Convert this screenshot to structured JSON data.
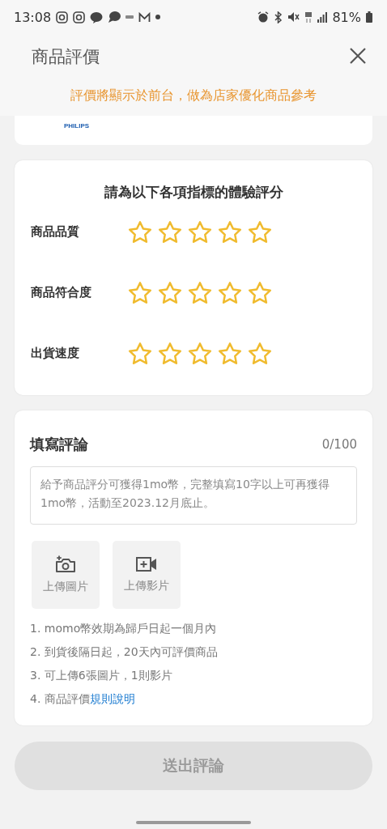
{
  "status_bar": {
    "time": "13:08",
    "battery": "81%"
  },
  "header": {
    "title": "商品評價",
    "notice": "評價將顯示於前台，做為店家優化商品參考"
  },
  "product": {
    "brand": "PHILIPS"
  },
  "rating": {
    "title": "請為以下各項指標的體驗評分",
    "criteria": [
      {
        "label": "商品品質",
        "stars": 0
      },
      {
        "label": "商品符合度",
        "stars": 0
      },
      {
        "label": "出貨速度",
        "stars": 0
      }
    ]
  },
  "comment": {
    "title": "填寫評論",
    "counter": "0/100",
    "placeholder": "給予商品評分可獲得1mo幣，完整填寫10字以上可再獲得1mo幣，活動至2023.12月底止。",
    "uploads": [
      {
        "kind": "photo",
        "label": "上傳圖片"
      },
      {
        "kind": "video",
        "label": "上傳影片"
      }
    ],
    "rules": [
      {
        "text": "1. momo幣效期為歸戶日起一個月內"
      },
      {
        "text": "2. 到貨後隔日起，20天內可評價商品"
      },
      {
        "text": "3. 可上傳6張圖片，1則影片"
      },
      {
        "text": "4. 商品評價",
        "link": "規則說明"
      }
    ]
  },
  "submit": {
    "label": "送出評論",
    "disabled": true
  }
}
